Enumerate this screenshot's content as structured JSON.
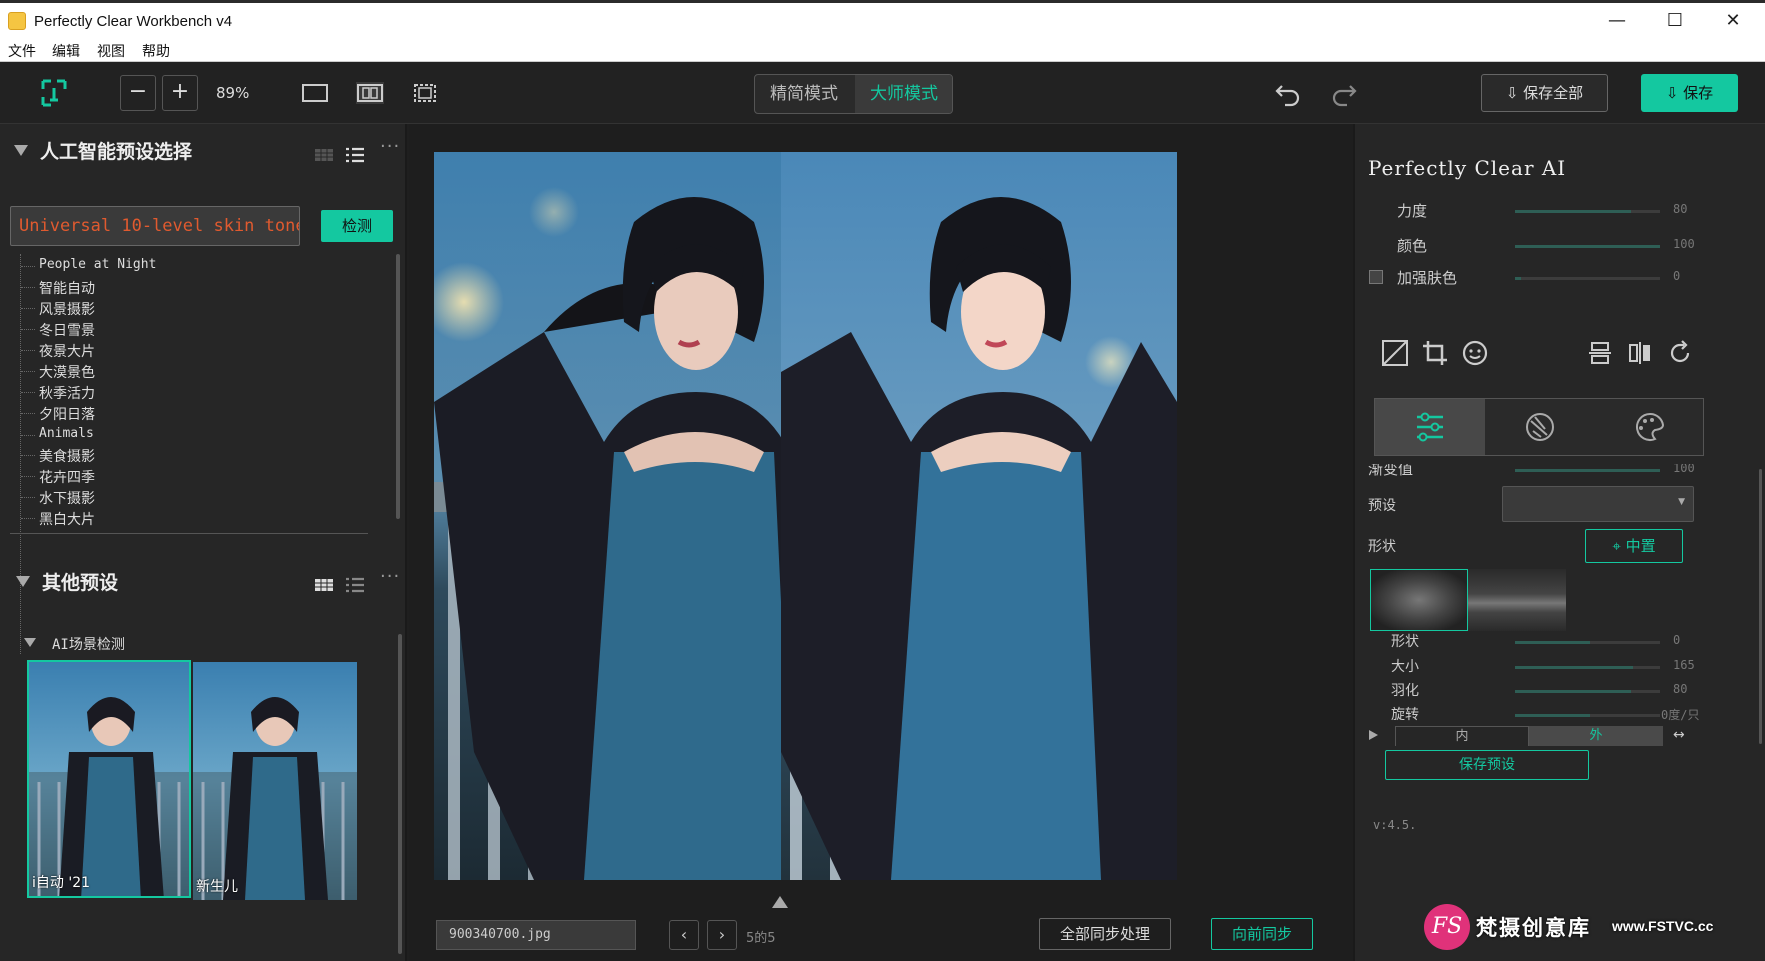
{
  "window": {
    "title": "Perfectly Clear Workbench v4",
    "minimize": "—",
    "maximize": "☐",
    "close": "✕"
  },
  "menu": [
    "文件",
    "编辑",
    "视图",
    "帮助"
  ],
  "toolbar": {
    "zoom": "89%",
    "zoom_out": "−",
    "zoom_in": "+",
    "mode_simple": "精简模式",
    "mode_master": "大师模式",
    "save_all": "保存全部",
    "save": "保存",
    "accent": "#14c8a0"
  },
  "left": {
    "ai_presets_title": "人工智能预设选择",
    "search_value": "Universal 10-level skin tone",
    "detect": "检测",
    "presets": [
      "People at Night",
      "智能自动",
      "风景摄影",
      "冬日雪景",
      "夜景大片",
      "大漠景色",
      "秋季活力",
      "夕阳日落",
      "Animals",
      "美食摄影",
      "花卉四季",
      "水下摄影",
      "黑白大片"
    ],
    "other_title": "其他预设",
    "ai_scene": "AI场景检测",
    "thumbs": [
      "i自动 '21",
      "新生儿"
    ]
  },
  "center": {
    "file": "900340700.jpg",
    "prev": "‹",
    "next": "›",
    "pager": "5的5",
    "sync_all": "全部同步处理",
    "sync_forward": "向前同步"
  },
  "right": {
    "title": "Perfectly Clear AI",
    "sliders_top": [
      {
        "label": "力度",
        "value": "80",
        "fraction": 0.8
      },
      {
        "label": "颜色",
        "value": "100",
        "fraction": 1.0
      },
      {
        "label": "加强肤色",
        "value": "0",
        "fraction": 0.0
      }
    ],
    "partial_label": "渐变值",
    "partial_value": "100",
    "preset_label": "预设",
    "shape_label": "形状",
    "center_btn": "中置",
    "sliders_bottom": [
      {
        "label": "形状",
        "value": "0",
        "fraction": 0.5
      },
      {
        "label": "大小",
        "value": "165",
        "fraction": 0.8
      },
      {
        "label": "羽化",
        "value": "80",
        "fraction": 0.8
      },
      {
        "label": "旋转",
        "value": "0度/只",
        "fraction": 0.5
      }
    ],
    "seg_inner": "内",
    "seg_outer": "外",
    "save_preset": "保存预设",
    "version": "v:4.5."
  },
  "watermark": {
    "logo": "FS",
    "text": "梵摄创意库",
    "url": "www.FSTVC.cc"
  }
}
